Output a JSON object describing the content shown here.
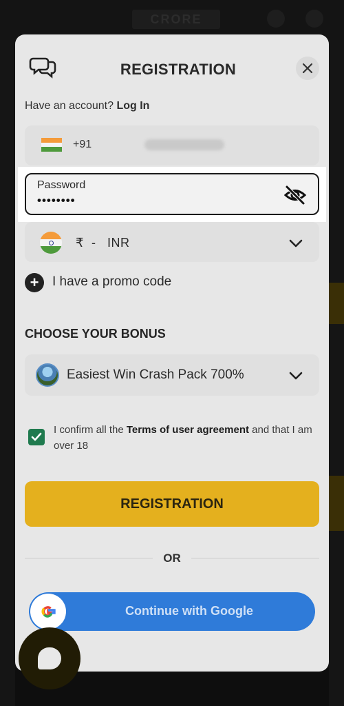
{
  "background_app": {
    "logo": "CRORE"
  },
  "modal": {
    "title": "REGISTRATION",
    "have_account": "Have an account?",
    "login_link": "Log In",
    "phone": {
      "country_code": "+91",
      "number_masked": ""
    },
    "password": {
      "label": "Password",
      "value": "••••••••"
    },
    "currency": {
      "symbol": "₹",
      "separator": "-",
      "code": "INR"
    },
    "promo": {
      "label": "I have a promo code"
    },
    "bonus": {
      "heading": "CHOOSE YOUR BONUS",
      "selected": "Easiest Win Crash Pack 700%"
    },
    "terms": {
      "prefix": "I confirm all the ",
      "link": "Terms of user agreement",
      "suffix": " and that I am over 18",
      "checked": true
    },
    "register_button": "REGISTRATION",
    "divider": "OR",
    "google_button": "Continue with Google"
  },
  "colors": {
    "accent_yellow": "#e4b01e",
    "google_blue": "#2f7bd9",
    "checkbox_green": "#1f7a4e"
  },
  "icons": [
    "chat-icon",
    "close-icon",
    "india-flag-icon",
    "eye-off-icon",
    "chevron-down-icon",
    "plus-icon",
    "check-icon",
    "google-icon",
    "chat-bubble-icon"
  ]
}
